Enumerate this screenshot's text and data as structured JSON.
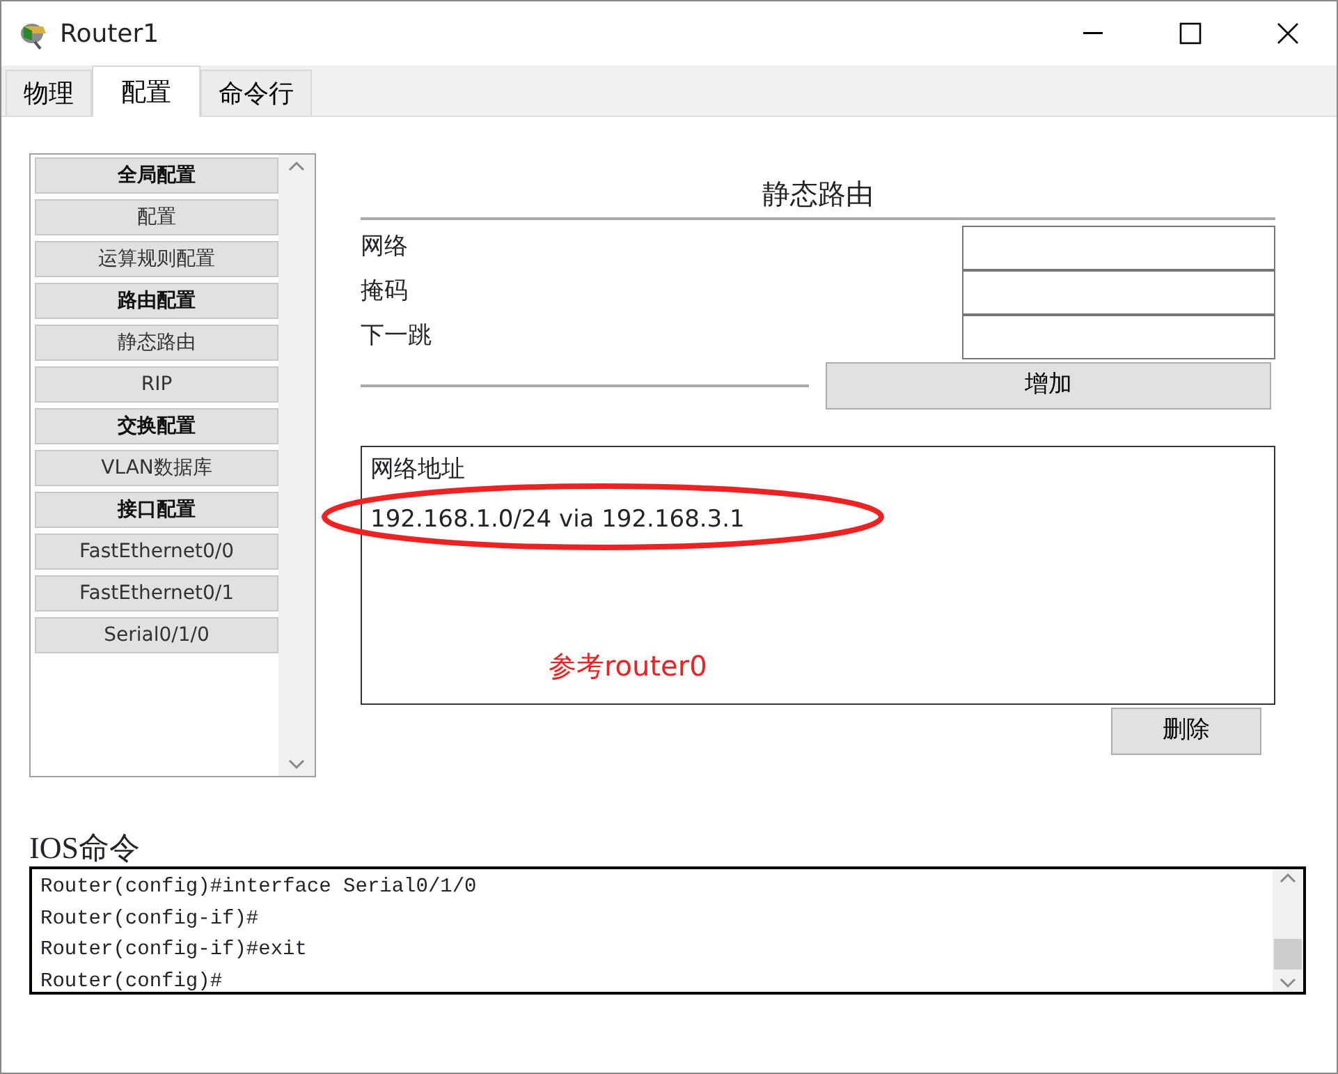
{
  "window": {
    "title": "Router1"
  },
  "tabs": [
    {
      "label": "物理",
      "selected": false
    },
    {
      "label": "配置",
      "selected": true
    },
    {
      "label": "命令行",
      "selected": false
    }
  ],
  "sidebar": {
    "items": [
      {
        "label": "全局配置",
        "kind": "header"
      },
      {
        "label": "配置",
        "kind": "item"
      },
      {
        "label": "运算规则配置",
        "kind": "item"
      },
      {
        "label": "路由配置",
        "kind": "header"
      },
      {
        "label": "静态路由",
        "kind": "item"
      },
      {
        "label": "RIP",
        "kind": "item"
      },
      {
        "label": "交换配置",
        "kind": "header"
      },
      {
        "label": "VLAN数据库",
        "kind": "item"
      },
      {
        "label": "接口配置",
        "kind": "header"
      },
      {
        "label": "FastEthernet0/0",
        "kind": "item"
      },
      {
        "label": "FastEthernet0/1",
        "kind": "item"
      },
      {
        "label": "Serial0/1/0",
        "kind": "item"
      }
    ]
  },
  "panel": {
    "title": "静态路由",
    "fields": [
      {
        "label": "网络"
      },
      {
        "label": "掩码"
      },
      {
        "label": "下一跳"
      }
    ],
    "add_button": "增加",
    "routes": {
      "heading": "网络地址",
      "items": [
        "192.168.1.0/24 via 192.168.3.1"
      ]
    },
    "annotation": {
      "note": "参考router0",
      "color": "#ee2222"
    },
    "delete_button": "删除"
  },
  "console": {
    "label": "IOS命令",
    "lines": [
      "Router(config)#interface Serial0/1/0",
      "Router(config-if)#",
      "Router(config-if)#exit",
      "Router(config)#"
    ]
  }
}
